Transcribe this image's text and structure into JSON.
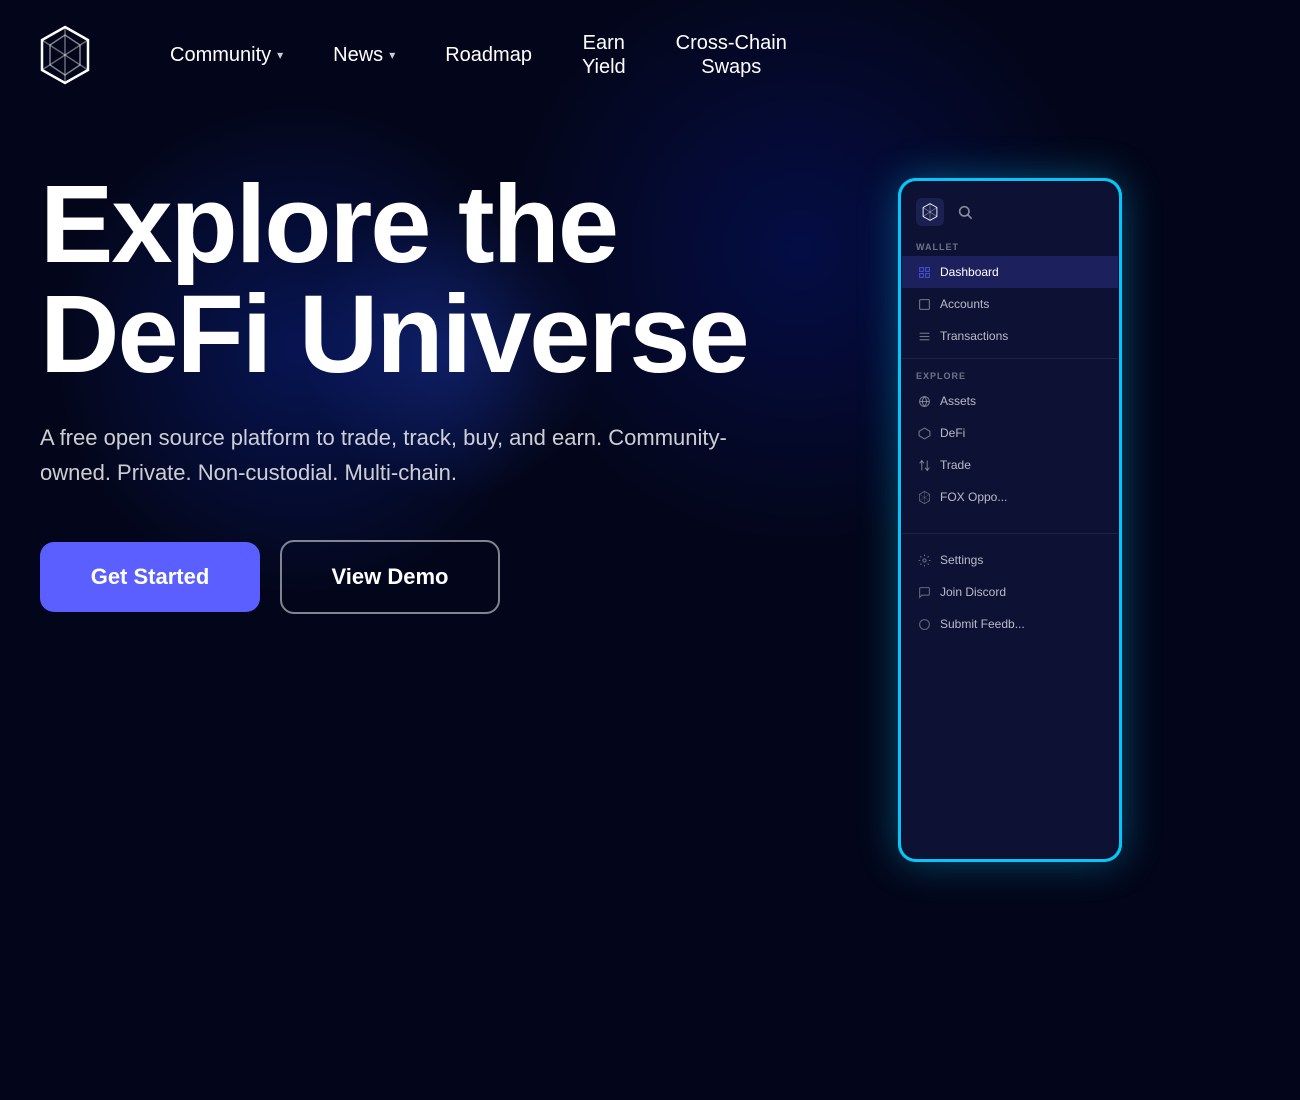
{
  "nav": {
    "logo_alt": "ShapeShift Fox Logo",
    "items": [
      {
        "label": "Community",
        "has_dropdown": true,
        "id": "community"
      },
      {
        "label": "News",
        "has_dropdown": true,
        "id": "news"
      },
      {
        "label": "Roadmap",
        "has_dropdown": false,
        "id": "roadmap"
      },
      {
        "label": "Earn\nYield",
        "has_dropdown": false,
        "id": "earn-yield"
      },
      {
        "label": "Cross-Chain\nSwaps",
        "has_dropdown": false,
        "id": "crosschain-swaps"
      }
    ]
  },
  "hero": {
    "title_line1": "Explore the",
    "title_line2": "DeFi Universe",
    "subtitle": "A free open source platform to trade, track, buy, and earn. Community-owned. Private. Non-custodial. Multi-chain.",
    "btn_primary": "Get Started",
    "btn_secondary": "View Demo"
  },
  "app_preview": {
    "section_wallet": "WALLET",
    "section_explore": "EXPLORE",
    "menu_wallet": [
      {
        "label": "Dashboard",
        "active": true,
        "icon": "▦"
      },
      {
        "label": "Accounts",
        "active": false,
        "icon": "⬜"
      },
      {
        "label": "Transactions",
        "active": false,
        "icon": "≡"
      }
    ],
    "menu_explore": [
      {
        "label": "Assets",
        "active": false,
        "icon": "◎"
      },
      {
        "label": "DeFi",
        "active": false,
        "icon": "◈"
      },
      {
        "label": "Trade",
        "active": false,
        "icon": "↕"
      },
      {
        "label": "FOX Oppo...",
        "active": false,
        "icon": "🦊"
      }
    ],
    "menu_bottom": [
      {
        "label": "Settings",
        "icon": "⚙"
      },
      {
        "label": "Join Discord",
        "icon": "💬"
      },
      {
        "label": "Submit Feedb...",
        "icon": "○"
      }
    ]
  }
}
